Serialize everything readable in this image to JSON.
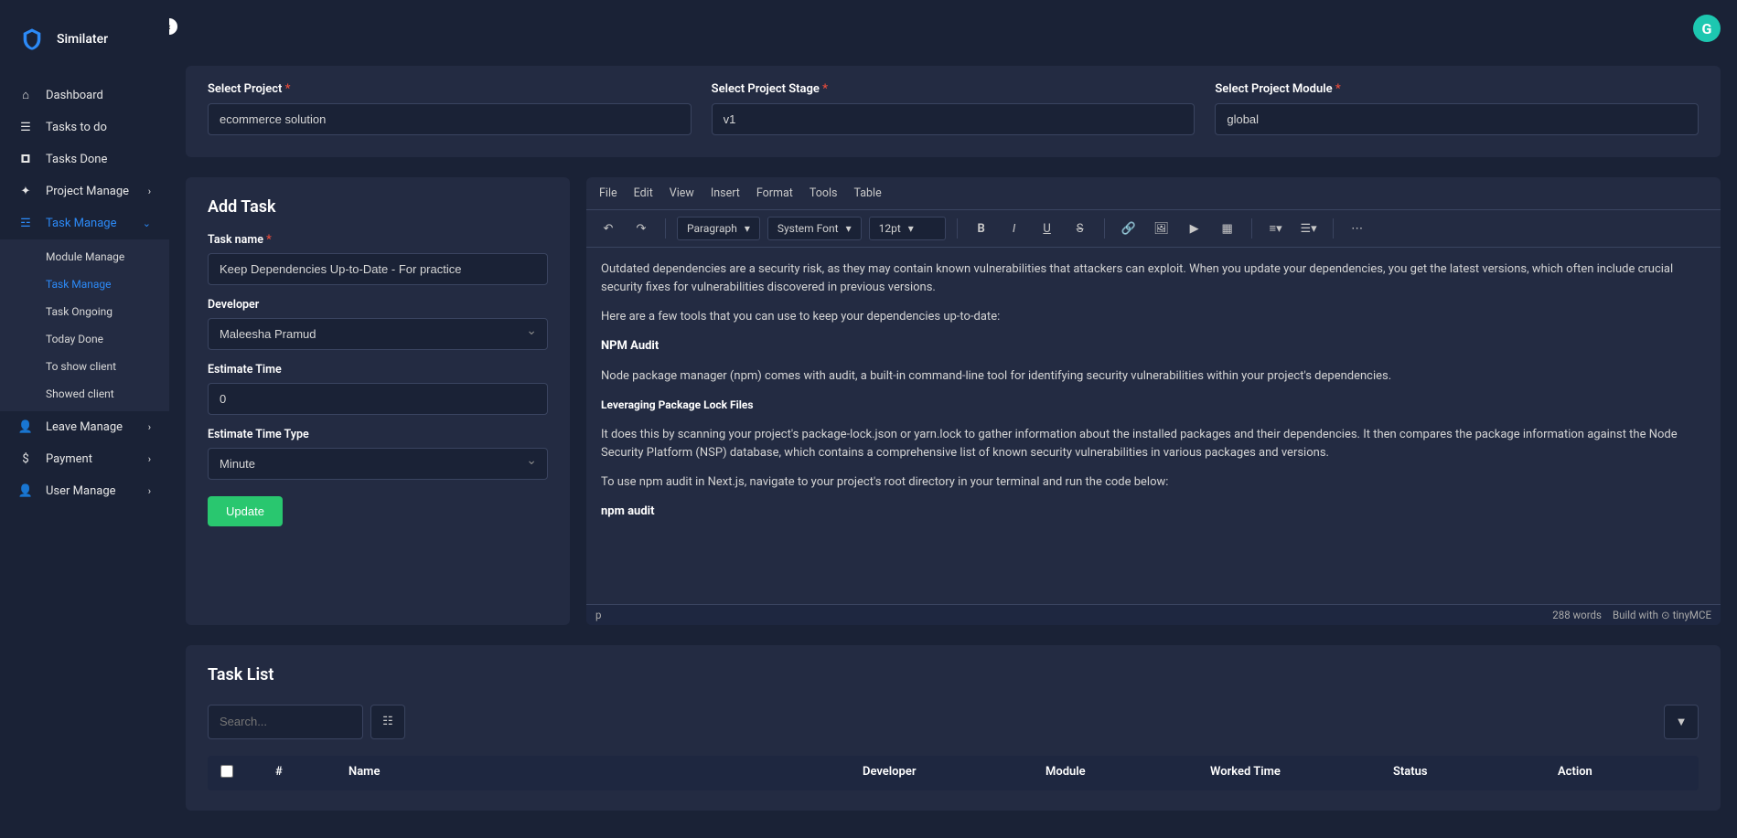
{
  "brand": {
    "name": "Similater"
  },
  "sidebar": {
    "items": [
      {
        "label": "Dashboard",
        "icon": "home"
      },
      {
        "label": "Tasks to do",
        "icon": "list"
      },
      {
        "label": "Tasks Done",
        "icon": "briefcase"
      },
      {
        "label": "Project Manage",
        "icon": "gear",
        "expandable": true
      },
      {
        "label": "Task Manage",
        "icon": "list-check",
        "expandable": true,
        "active": true
      },
      {
        "label": "Leave Manage",
        "icon": "user",
        "expandable": true
      },
      {
        "label": "Payment",
        "icon": "dollar",
        "expandable": true
      },
      {
        "label": "User Manage",
        "icon": "user",
        "expandable": true
      }
    ],
    "task_manage_sub": [
      {
        "label": "Module Manage"
      },
      {
        "label": "Task Manage",
        "active": true
      },
      {
        "label": "Task Ongoing"
      },
      {
        "label": "Today Done"
      },
      {
        "label": "To show client"
      },
      {
        "label": "Showed client"
      }
    ]
  },
  "selects": {
    "project_label": "Select Project",
    "project_value": "ecommerce solution",
    "stage_label": "Select Project Stage",
    "stage_value": "v1",
    "module_label": "Select Project Module",
    "module_value": "global"
  },
  "add_task": {
    "title": "Add Task",
    "task_name_label": "Task name",
    "task_name_value": "Keep Dependencies Up-to-Date - For practice",
    "developer_label": "Developer",
    "developer_value": "Maleesha Pramud",
    "estimate_label": "Estimate Time",
    "estimate_value": "0",
    "estimate_type_label": "Estimate Time Type",
    "estimate_type_value": "Minute",
    "update_btn": "Update"
  },
  "editor": {
    "menus": [
      "File",
      "Edit",
      "View",
      "Insert",
      "Format",
      "Tools",
      "Table"
    ],
    "block_format": "Paragraph",
    "font_family": "System Font",
    "font_size": "12pt",
    "body": {
      "p1": "Outdated dependencies are a security risk, as they may contain known vulnerabilities that attackers can exploit. When you update your dependencies, you get the latest versions, which often include crucial security fixes for vulnerabilities discovered in previous versions.",
      "p2": "Here are a few tools that you can use to keep your dependencies up-to-date:",
      "h1": "NPM Audit",
      "p3": "Node package manager (npm) comes with audit, a built-in command-line tool for identifying security vulnerabilities within your project's dependencies.",
      "h2": "Leveraging Package Lock Files",
      "p4": "It does this by scanning your project's package-lock.json or yarn.lock to gather information about the installed packages and their dependencies. It then compares the package information against the Node Security Platform (NSP) database, which contains a comprehensive list of known security vulnerabilities in various packages and versions.",
      "p5": "To use npm audit in Next.js, navigate to your project's root directory in your terminal and run the code below:",
      "h3": "npm audit"
    },
    "status_path": "p",
    "word_count": "288 words",
    "build_with": "Build with",
    "tinymce": "tinyMCE"
  },
  "task_list": {
    "title": "Task List",
    "search_placeholder": "Search...",
    "columns": [
      "#",
      "Name",
      "Developer",
      "Module",
      "Worked Time",
      "Status",
      "Action"
    ]
  }
}
